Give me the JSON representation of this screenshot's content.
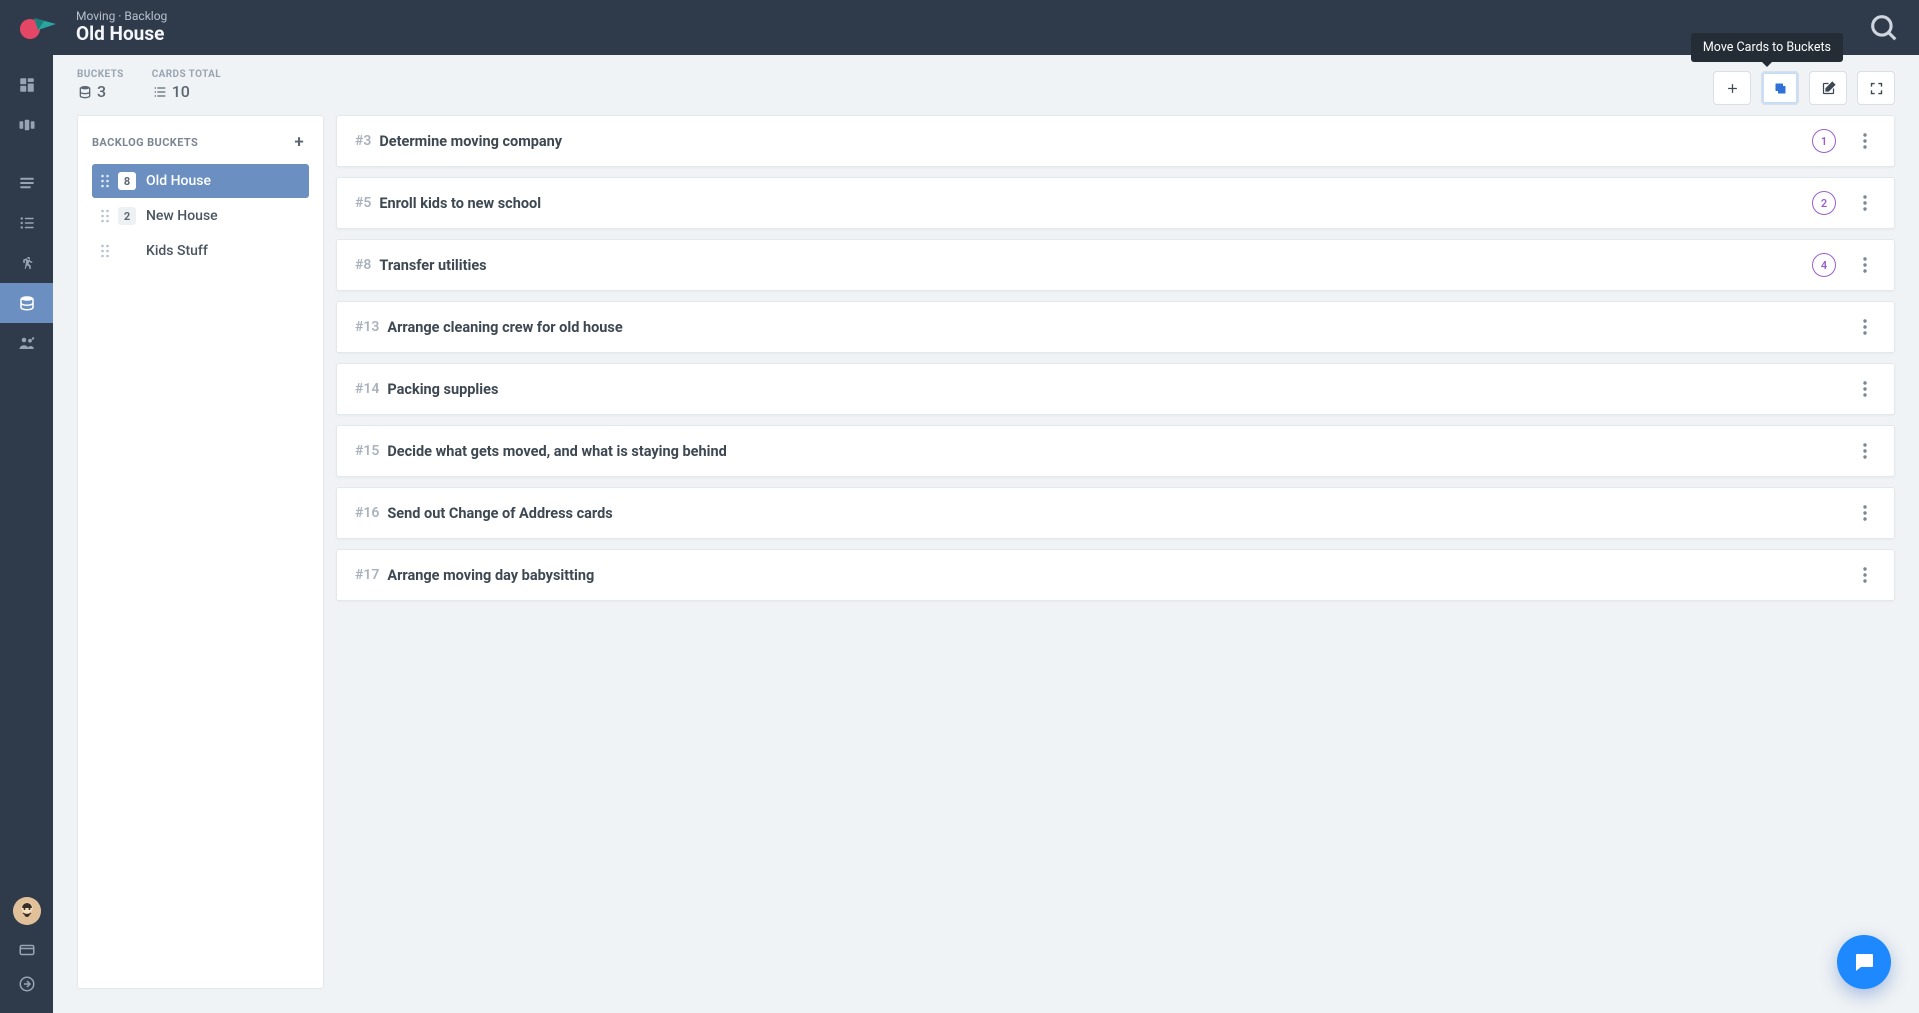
{
  "header": {
    "breadcrumb": "Moving · Backlog",
    "page_title": "Old House"
  },
  "stats": {
    "buckets_label": "BUCKETS",
    "buckets_value": "3",
    "cards_label": "CARDS TOTAL",
    "cards_value": "10"
  },
  "toolbar": {
    "tooltip": "Move Cards to Buckets"
  },
  "buckets_panel": {
    "title": "BACKLOG BUCKETS",
    "items": [
      {
        "name": "Old House",
        "count": "8",
        "active": true
      },
      {
        "name": "New House",
        "count": "2",
        "active": false
      },
      {
        "name": "Kids Stuff",
        "count": "",
        "active": false
      }
    ]
  },
  "cards": [
    {
      "id": "#3",
      "title": "Determine moving company",
      "badge": "1"
    },
    {
      "id": "#5",
      "title": "Enroll kids to new school",
      "badge": "2"
    },
    {
      "id": "#8",
      "title": "Transfer utilities",
      "badge": "4"
    },
    {
      "id": "#13",
      "title": "Arrange cleaning crew for old house",
      "badge": ""
    },
    {
      "id": "#14",
      "title": "Packing supplies",
      "badge": ""
    },
    {
      "id": "#15",
      "title": "Decide what gets moved, and what is staying behind",
      "badge": ""
    },
    {
      "id": "#16",
      "title": "Send out Change of Address cards",
      "badge": ""
    },
    {
      "id": "#17",
      "title": "Arrange moving day babysitting",
      "badge": ""
    }
  ],
  "colors": {
    "rail_bg": "#2f3a4a",
    "accent_blue": "#6a8fc0",
    "badge_purple": "#9a5fcf",
    "fab_blue": "#1e88ff"
  }
}
